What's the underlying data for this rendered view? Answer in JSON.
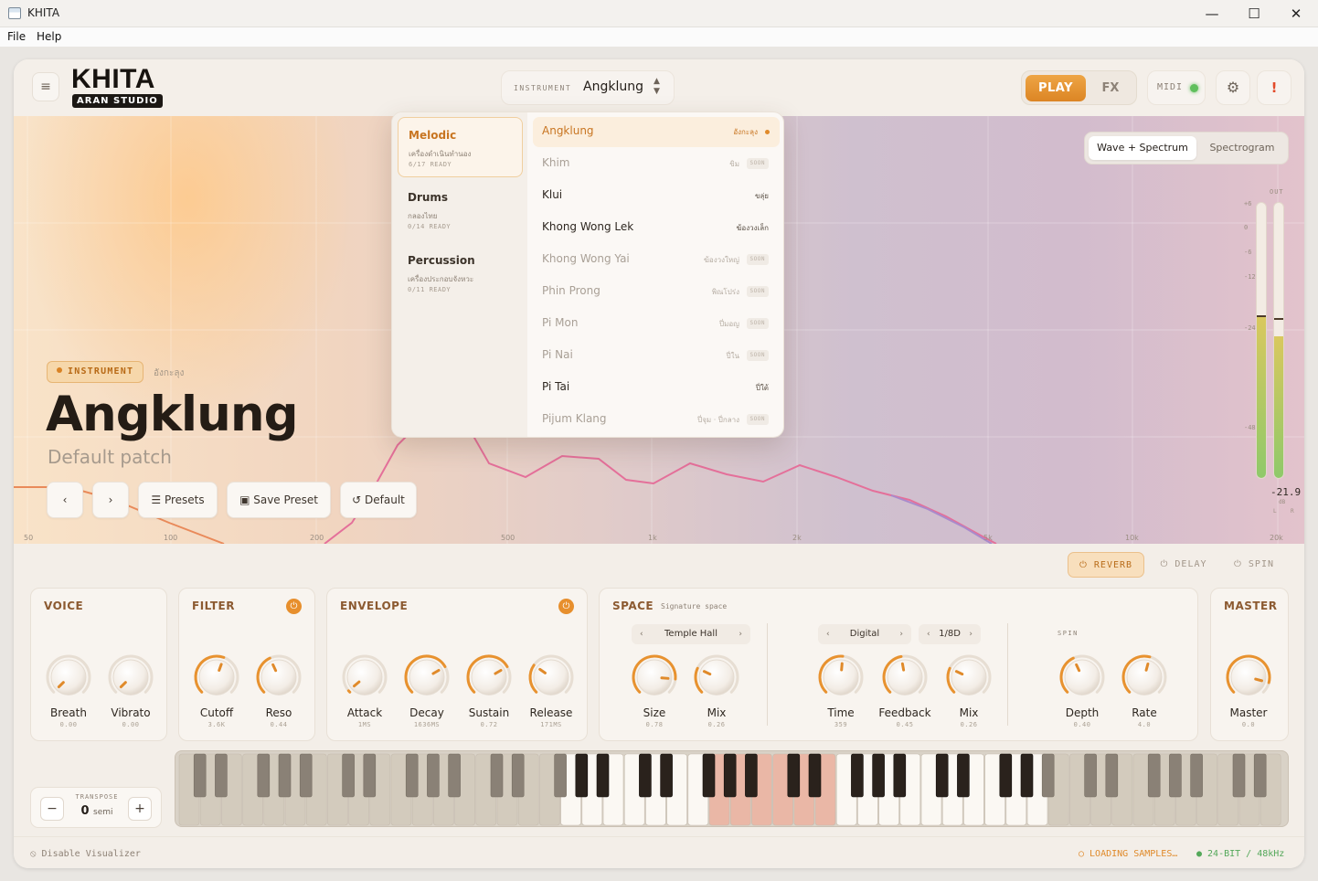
{
  "window": {
    "title": "KHITA",
    "minimize": "—",
    "maximize": "☐",
    "close": "✕"
  },
  "menu": {
    "file": "File",
    "help": "Help"
  },
  "header": {
    "hamburger": "≡",
    "brand": "KHITA",
    "brand_sub": "ARAN STUDIO",
    "instrument_label": "INSTRUMENT",
    "instrument_value": "Angklung",
    "play": "PLAY",
    "fx": "FX",
    "midi": "MIDI",
    "settings": "⚙",
    "alert": "!"
  },
  "visualizer": {
    "view_wave": "Wave + Spectrum",
    "view_spectrogram": "Spectrogram",
    "freq_labels": [
      "50",
      "100",
      "200",
      "500",
      "1k",
      "2k",
      "5k",
      "10k",
      "20k"
    ],
    "meter": {
      "label": "OUT",
      "ticks": [
        "+6",
        "0",
        "-6",
        "-12",
        "-24",
        "-48"
      ],
      "reading": "-21.9",
      "unit": "dB",
      "left": "L",
      "right": "R",
      "left_level": 0.58,
      "right_level": 0.51
    }
  },
  "instrument_info": {
    "badge": "INSTRUMENT",
    "thai": "อังกะลุง",
    "name": "Angklung",
    "patch": "Default patch",
    "prev": "‹",
    "next": "›",
    "presets": "☰ Presets",
    "save_preset": "▣ Save Preset",
    "default": "↺ Default"
  },
  "dropdown": {
    "categories": [
      {
        "name": "Melodic",
        "thai": "เครื่องดำเนินทำนอง",
        "ready": "6/17 READY"
      },
      {
        "name": "Drums",
        "thai": "กลองไทย",
        "ready": "0/14 READY"
      },
      {
        "name": "Percussion",
        "thai": "เครื่องประกอบจังหวะ",
        "ready": "0/11 READY"
      }
    ],
    "instruments": [
      {
        "name": "Angklung",
        "thai": "อังกะลุง",
        "soon": ""
      },
      {
        "name": "Khim",
        "thai": "ขิม",
        "soon": "SOON"
      },
      {
        "name": "Klui",
        "thai": "ขลุ่ย",
        "soon": ""
      },
      {
        "name": "Khong Wong Lek",
        "thai": "ฆ้องวงเล็ก",
        "soon": ""
      },
      {
        "name": "Khong Wong Yai",
        "thai": "ฆ้องวงใหญ่",
        "soon": "SOON"
      },
      {
        "name": "Phin Prong",
        "thai": "พิณโปร่ง",
        "soon": "SOON"
      },
      {
        "name": "Pi Mon",
        "thai": "ปี่มอญ",
        "soon": "SOON"
      },
      {
        "name": "Pi Nai",
        "thai": "ปี่ใน",
        "soon": "SOON"
      },
      {
        "name": "Pi Tai",
        "thai": "ปี่ใต้",
        "soon": ""
      },
      {
        "name": "Pijum Klang",
        "thai": "ปี่จุม · ปี่กลาง",
        "soon": "SOON"
      }
    ]
  },
  "fx_tabs": {
    "reverb": "⏻ REVERB",
    "delay": "⏻ DELAY",
    "spin": "⏻ SPIN"
  },
  "panels": {
    "voice": {
      "title": "VOICE",
      "knobs": [
        {
          "label": "Breath",
          "value": "0.00"
        },
        {
          "label": "Vibrato",
          "value": "0.00"
        }
      ]
    },
    "filter": {
      "title": "FILTER",
      "power": "⏻",
      "knobs": [
        {
          "label": "Cutoff",
          "value": "3.6K"
        },
        {
          "label": "Reso",
          "value": "0.44"
        }
      ]
    },
    "envelope": {
      "title": "ENVELOPE",
      "power": "⏻",
      "knobs": [
        {
          "label": "Attack",
          "value": "1MS"
        },
        {
          "label": "Decay",
          "value": "1636MS"
        },
        {
          "label": "Sustain",
          "value": "0.72"
        },
        {
          "label": "Release",
          "value": "171MS"
        }
      ]
    },
    "space": {
      "title": "SPACE",
      "subtitle": "Signature space",
      "reverb_type": "Temple Hall",
      "delay_type": "Digital",
      "delay_time": "1/8D",
      "spin_tag": "SPIN",
      "knobs": [
        {
          "label": "Size",
          "value": "0.78"
        },
        {
          "label": "Mix",
          "value": "0.26"
        },
        {
          "label": "Time",
          "value": "359"
        },
        {
          "label": "Feedback",
          "value": "0.45"
        },
        {
          "label": "Mix",
          "value": "0.26"
        },
        {
          "label": "Depth",
          "value": "0.40"
        },
        {
          "label": "Rate",
          "value": "4.0"
        }
      ]
    },
    "master": {
      "title": "MASTER",
      "knobs": [
        {
          "label": "Master",
          "value": "0.0"
        }
      ]
    }
  },
  "transpose": {
    "label": "TRANSPOSE",
    "value": "0",
    "unit": "semi",
    "minus": "−",
    "plus": "+"
  },
  "status": {
    "disable_viz": "⦸ Disable Visualizer",
    "loading": "○ LOADING SAMPLES…",
    "bitrate": "● 24-BIT / 48kHz"
  },
  "colors": {
    "accent": "#e08a2a",
    "midi_led": "#5fbf5c",
    "alert": "#e24a2a"
  }
}
